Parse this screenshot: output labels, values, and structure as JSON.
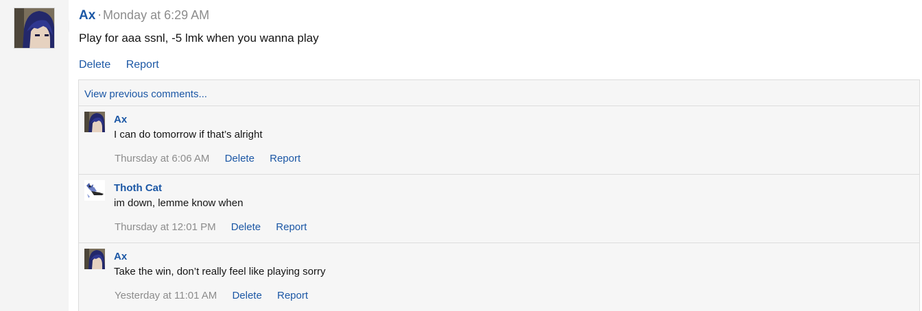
{
  "post": {
    "author": "Ax",
    "separator": "·",
    "time": "Monday at 6:29 AM",
    "body": "Play for aaa ssnl, -5 lmk when you wanna play",
    "actions": {
      "delete": "Delete",
      "report": "Report"
    }
  },
  "comments": {
    "view_previous": "View previous comments...",
    "items": [
      {
        "author": "Ax",
        "text": "I can do tomorrow if that’s alright",
        "time": "Thursday at 6:06 AM",
        "delete": "Delete",
        "report": "Report"
      },
      {
        "author": "Thoth Cat",
        "text": "im down, lemme know when",
        "time": "Thursday at 12:01 PM",
        "delete": "Delete",
        "report": "Report"
      },
      {
        "author": "Ax",
        "text": "Take the win, don’t really feel like playing sorry",
        "time": "Yesterday at 11:01 AM",
        "delete": "Delete",
        "report": "Report"
      }
    ]
  },
  "colors": {
    "link": "#1b57a5",
    "muted": "#8c8c8c",
    "panel": "#f6f6f6",
    "gutter": "#f4f4f4"
  }
}
